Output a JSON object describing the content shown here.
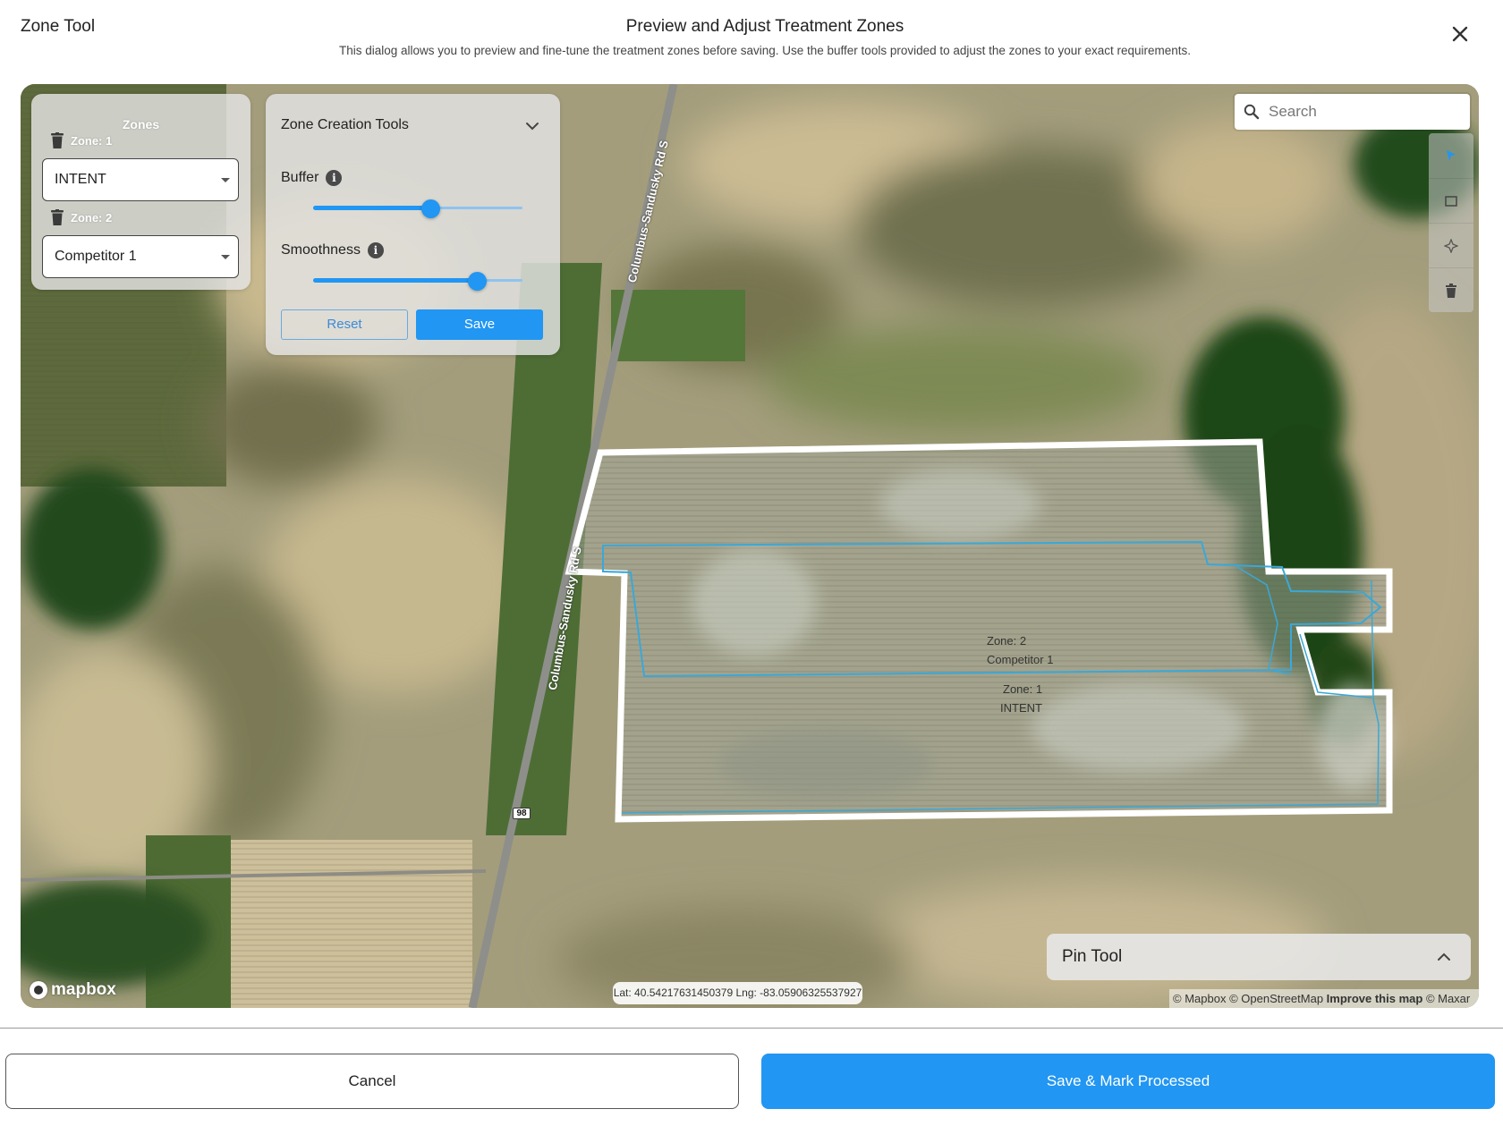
{
  "app_title": "Zone Tool",
  "dialog": {
    "title": "Preview and Adjust Treatment Zones",
    "subtitle": "This dialog allows you to preview and fine-tune the treatment zones before saving. Use the buffer tools provided to adjust the zones to your exact requirements."
  },
  "zones_panel": {
    "title": "Zones",
    "zones": [
      {
        "label": "Zone: 1",
        "selected": "INTENT"
      },
      {
        "label": "Zone: 2",
        "selected": "Competitor 1"
      }
    ]
  },
  "zone_tools": {
    "title": "Zone Creation Tools",
    "buffer_label": "Buffer",
    "buffer_value_pct": 56,
    "smoothness_label": "Smoothness",
    "smoothness_value_pct": 78,
    "reset_label": "Reset",
    "save_label": "Save"
  },
  "search": {
    "placeholder": "Search"
  },
  "map_labels": {
    "road_1": "Columbus-Sandusky Rd S",
    "road_2": "Columbus-Sandusky Rd S",
    "route": "98",
    "zone2_name": "Zone: 2",
    "zone2_value": "Competitor 1",
    "zone1_name": "Zone: 1",
    "zone1_value": "INTENT"
  },
  "pin_tool": {
    "title": "Pin Tool"
  },
  "coordinates": "Lat: 40.54217631450379 Lng: -83.05906325537927",
  "attribution": {
    "mapbox": "© Mapbox",
    "osm": "© OpenStreetMap",
    "improve": "Improve this map",
    "maxar": "© Maxar"
  },
  "logo": "mapbox",
  "footer": {
    "cancel_label": "Cancel",
    "primary_label": "Save & Mark Processed"
  },
  "colors": {
    "accent": "#2196f3",
    "field_outline": "#ffffff",
    "zone_outline": "#3aa8d8"
  },
  "icons": [
    "close-icon",
    "trash-icon",
    "chevron-down-icon",
    "info-icon",
    "search-icon",
    "draw-polygon-icon",
    "draw-rectangle-icon",
    "combine-icon",
    "trash-icon",
    "chevron-up-icon"
  ]
}
